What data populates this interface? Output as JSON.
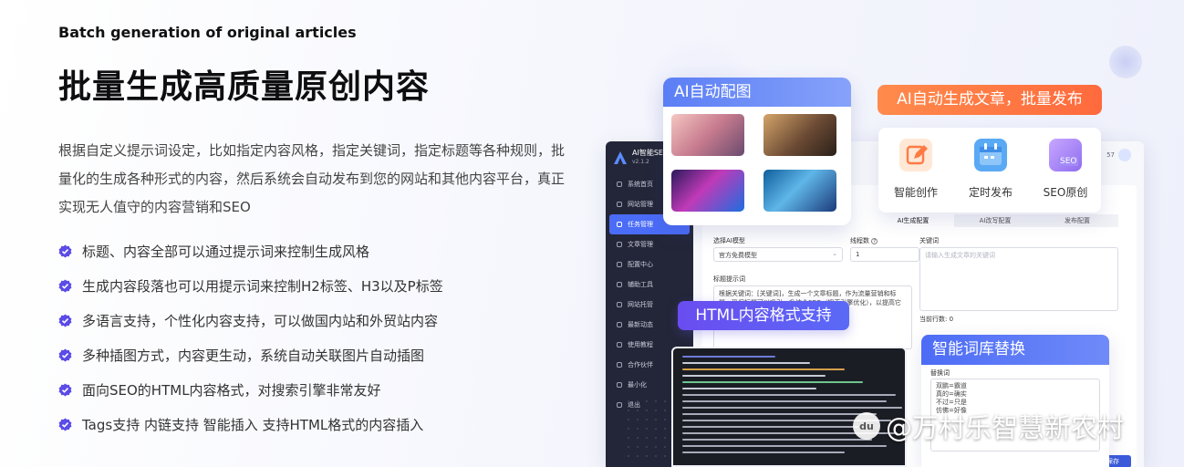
{
  "subtitle": "Batch generation of original articles",
  "headline": "批量生成高质量原创内容",
  "description": "根据自定义提示词设定，比如指定内容风格，指定关键词，指定标题等各种规则，批量化的生成各种形式的内容，然后系统会自动发布到您的网站和其他内容平台，真正实现无人值守的内容营销和SEO",
  "features": [
    "标题、内容全部可以通过提示词来控制生成风格",
    "生成内容段落也可以用提示词来控制H2标签、H3以及P标签",
    "多语言支持，个性化内容支持，可以做国内站和外贸站内容",
    "多种插图方式，内容更生动，系统自动关联图片自动插图",
    "面向SEO的HTML内容格式，对搜索引擎非常友好",
    "Tags支持 内链支持 智能插入 支持HTML格式的内容插入"
  ],
  "colors": {
    "accent": "#5b4be8",
    "blue": "#4d6cf6",
    "orange": "#ff7a45",
    "sidebar": "#232638"
  },
  "app": {
    "logo_text": "AI智能SE",
    "version": "v2.1.2",
    "user_suffix": "57",
    "nav": [
      "系统首页",
      "网站管理",
      "任务管理",
      "文章管理",
      "配置中心",
      "辅助工具",
      "网站托管",
      "最新动态",
      "使用教程",
      "合作伙伴",
      "最小化",
      "退出"
    ],
    "active_nav": 2,
    "tabs": [
      "AI生成配置",
      "AI改写配置",
      "发布配置"
    ],
    "active_tab": 0,
    "form": {
      "model_label": "选择AI模型",
      "model_value": "官方免费模型",
      "threads_label": "线程数",
      "threads_value": "1",
      "keywords_label": "关键词",
      "keywords_placeholder": "请输入生成文章的关键词",
      "title_prompt_label": "标题提示词",
      "title_prompt_value": "根据关键词：[关键词]，生成一个文章标题，作为流量营销和标题，确保标题可以吸引，升结合SEO（搜索引擎优化），以提高它在搜索标题，不要返回其他内容。",
      "line_count": "当前行数: 0",
      "save_label": "保存"
    }
  },
  "cards": {
    "ai_image_title": "AI自动配图",
    "ai_article_title": "AI自动生成文章，批量发布",
    "feature_items": [
      {
        "label": "智能创作",
        "icon": "edit-icon"
      },
      {
        "label": "定时发布",
        "icon": "calendar-icon"
      },
      {
        "label": "SEO原创",
        "icon": "seo-icon"
      }
    ],
    "seo_icon_text": "SEO",
    "html_format_title": "HTML内容格式支持",
    "lexicon_title": "智能词库替换",
    "lexicon_label": "替换词",
    "lexicon_entries": [
      "双鹏=霸道",
      "真的=确实",
      "不过=只是",
      "仿佛=好像"
    ]
  },
  "watermark": {
    "badge": "du",
    "text": "@万村乐智慧新农村"
  }
}
